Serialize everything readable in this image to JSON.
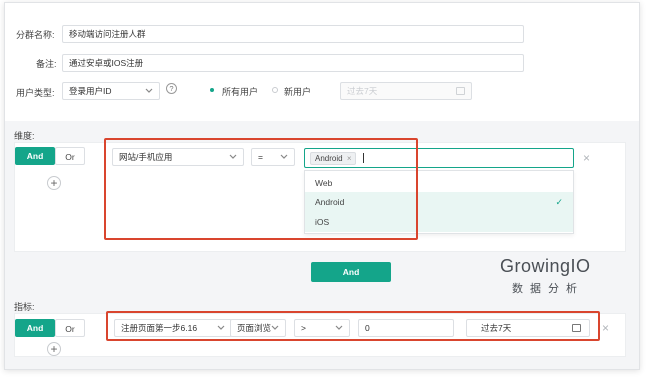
{
  "form": {
    "group_name_label": "分群名称:",
    "group_name_value": "移动端访问注册人群",
    "note_label": "备注:",
    "note_value": "通过安卓或IOS注册",
    "user_type_label": "用户类型:",
    "user_type_value": "登录用户ID",
    "radio_all_label": "所有用户",
    "radio_new_label": "新用户",
    "date_placeholder": "过去7天"
  },
  "dimension": {
    "section_label": "维度:",
    "and_label": "And",
    "or_label": "Or",
    "field_select": "网站/手机应用",
    "operator_select": "=",
    "tag_value": "Android",
    "tag_remove": "×",
    "dropdown_options": [
      {
        "label": "Web",
        "selected": false
      },
      {
        "label": "Android",
        "selected": true
      },
      {
        "label": "iOS",
        "selected": false
      }
    ],
    "check_mark": "✓"
  },
  "actions": {
    "and_button": "And"
  },
  "logo": {
    "brand": "GrowingIO",
    "subtitle": "数据分析"
  },
  "metric": {
    "section_label": "指标:",
    "and_label": "And",
    "or_label": "Or",
    "event_select": "注册页面第一步6.16",
    "measure_select": "页面浏览",
    "operator_select": ">",
    "value_input": "0",
    "date_range": "过去7天"
  },
  "colors": {
    "accent": "#14a58a",
    "highlight_border": "#d9452e"
  }
}
